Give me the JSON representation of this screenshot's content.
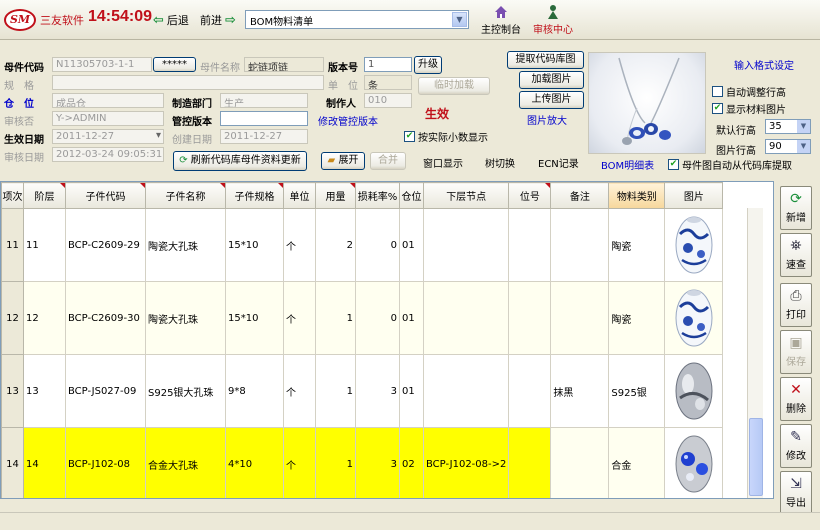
{
  "toolbar": {
    "logo_text": "SM",
    "brand": "三友软件",
    "clock": "14:54:09",
    "back": "后退",
    "forward": "前进",
    "doc_selected": "BOM物料清单",
    "main_console": "主控制台",
    "review_center": "审核中心",
    "colors": {
      "brand": "#c0101a",
      "arrow": "#1a8f3a"
    }
  },
  "form": {
    "parent_code_label": "母件代码",
    "parent_code_value": "N11305703-1-1",
    "parent_code_browse": "*****",
    "parent_name_label": "母件名称",
    "parent_name_value": "蛇链项链",
    "version_label": "版本号",
    "version_value": "1",
    "upgrade_btn": "升级",
    "spec_label": "规　格",
    "unit_label": "单　位",
    "unit_value": "条",
    "temp_add": "临时加载",
    "warehouse_label": "仓　位",
    "warehouse_value": "成品仓",
    "dept_label": "制造部门",
    "dept_value": "生产",
    "maker_label": "制作人",
    "maker_value": "010",
    "reviewer_label": "审核否",
    "reviewer_value": "Y->ADMIN",
    "control_ver_label": "管控版本",
    "modify_control": "修改管控版本",
    "effective_label": "生效",
    "eff_date_label": "生效日期",
    "eff_date_value": "2011-12-27",
    "create_date_label": "创建日期",
    "create_date_value": "2011-12-27",
    "actual_decimal": "按实际小数显示",
    "review_date_label": "审核日期",
    "review_date_value": "2012-03-24 09:05:31",
    "refresh_btn": "刷新代码库母件资料更新",
    "expand_btn": "展开",
    "merge_btn": "合并",
    "window_show": "窗口显示",
    "tree_switch": "树切换",
    "ecn": "ECN记录",
    "bom_detail": "BOM明细表",
    "get_code_img": "提取代码库图",
    "load_img": "加载图片",
    "upload_img": "上传图片",
    "zoom_img": "图片放大",
    "input_format": "输入格式设定",
    "auto_row": "自动调整行高",
    "show_material_img": "显示材料图片",
    "default_row_label": "默认行高",
    "default_row_value": "35",
    "img_row_label": "图片行高",
    "img_row_value": "90",
    "auto_fetch": "母件图自动从代码库提取"
  },
  "table": {
    "headers": [
      "项次",
      "阶层",
      "子件代码",
      "子件名称",
      "子件规格",
      "单位",
      "用量",
      "损耗率%",
      "仓位",
      "下层节点",
      "位号",
      "备注",
      "物料类别",
      "图片"
    ],
    "rows": [
      {
        "idx": "11",
        "level": "11",
        "code": "BCP-C2609-29",
        "name": "陶瓷大孔珠",
        "spec": "15*10",
        "unit": "个",
        "qty": "2",
        "loss": "0",
        "wh": "01",
        "node": "",
        "pos": "",
        "note": "",
        "cat": "陶瓷",
        "bead": "porcelain"
      },
      {
        "idx": "12",
        "level": "12",
        "code": "BCP-C2609-30",
        "name": "陶瓷大孔珠",
        "spec": "15*10",
        "unit": "个",
        "qty": "1",
        "loss": "0",
        "wh": "01",
        "node": "",
        "pos": "",
        "note": "",
        "cat": "陶瓷",
        "bead": "porcelain"
      },
      {
        "idx": "13",
        "level": "13",
        "code": "BCP-JS027-09",
        "name": "S925银大孔珠",
        "spec": "9*8",
        "unit": "个",
        "qty": "1",
        "loss": "3",
        "wh": "01",
        "node": "",
        "pos": "",
        "note": "抹黑",
        "cat": "S925银",
        "bead": "silver"
      },
      {
        "idx": "14",
        "level": "14",
        "code": "BCP-J102-08",
        "name": "合金大孔珠",
        "spec": "4*10",
        "unit": "个",
        "qty": "1",
        "loss": "3",
        "wh": "02",
        "node": "BCP-J102-08->2",
        "pos": "",
        "note": "",
        "cat": "合金",
        "bead": "alloy"
      }
    ]
  },
  "tools": {
    "add": "新增",
    "query": "速查",
    "print": "打印",
    "save": "保存",
    "delete": "删除",
    "modify": "修改",
    "export": "导出"
  }
}
